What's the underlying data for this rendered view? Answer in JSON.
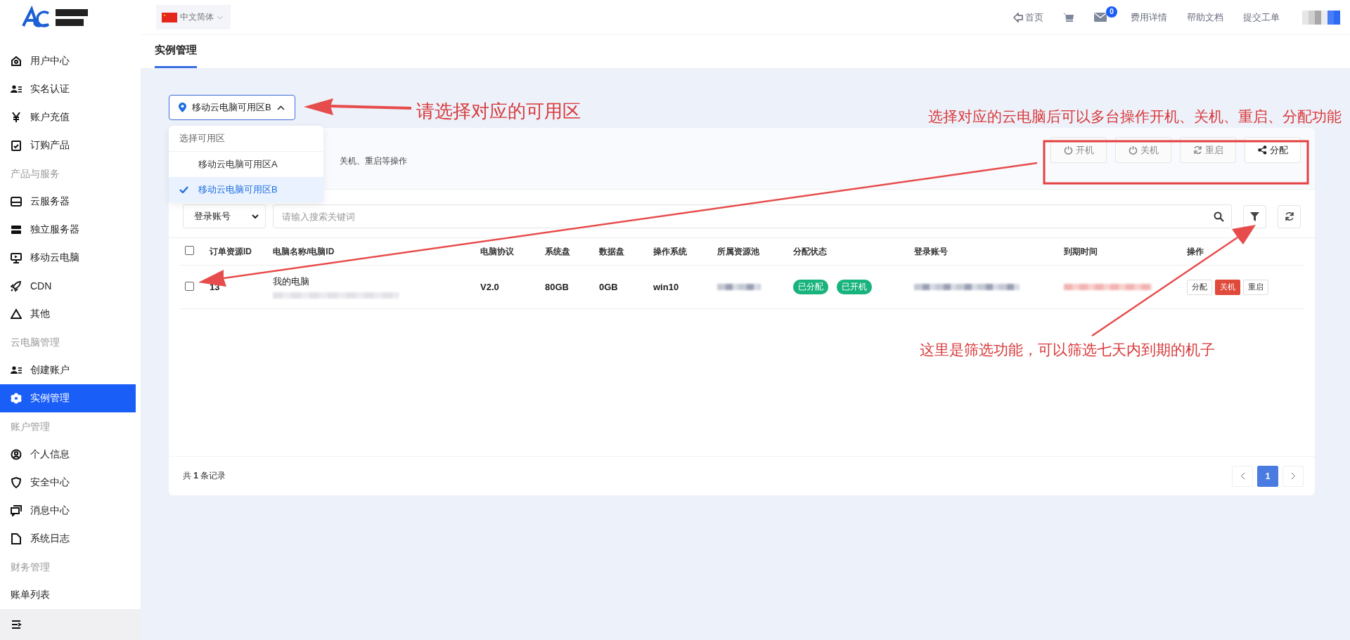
{
  "header": {
    "language": "中文简体",
    "nav": [
      {
        "kind": "home",
        "label": "首页"
      },
      {
        "kind": "cart"
      },
      {
        "kind": "mail",
        "badge": "0"
      },
      {
        "kind": "link",
        "label": "费用详情"
      },
      {
        "kind": "link",
        "label": "帮助文档"
      },
      {
        "kind": "link",
        "label": "提交工单"
      }
    ]
  },
  "sidebar": {
    "items": [
      {
        "kind": "item",
        "label": "用户中心",
        "selected": false
      },
      {
        "kind": "item",
        "label": "实名认证",
        "selected": false
      },
      {
        "kind": "item",
        "label": "账户充值",
        "selected": false
      },
      {
        "kind": "item",
        "label": "订购产品",
        "selected": false
      },
      {
        "kind": "heading",
        "label": "产品与服务"
      },
      {
        "kind": "item",
        "label": "云服务器",
        "selected": false
      },
      {
        "kind": "item",
        "label": "独立服务器",
        "selected": false
      },
      {
        "kind": "item",
        "label": "移动云电脑",
        "selected": false
      },
      {
        "kind": "item",
        "label": "CDN",
        "selected": false
      },
      {
        "kind": "item",
        "label": "其他",
        "selected": false
      },
      {
        "kind": "heading",
        "label": "云电脑管理"
      },
      {
        "kind": "item",
        "label": "创建账户",
        "selected": false
      },
      {
        "kind": "item",
        "label": "实例管理",
        "selected": true
      },
      {
        "kind": "heading",
        "label": "账户管理"
      },
      {
        "kind": "item",
        "label": "个人信息",
        "selected": false
      },
      {
        "kind": "item",
        "label": "安全中心",
        "selected": false
      },
      {
        "kind": "item",
        "label": "消息中心",
        "selected": false
      },
      {
        "kind": "item",
        "label": "系统日志",
        "selected": false
      },
      {
        "kind": "heading",
        "label": "财务管理"
      },
      {
        "kind": "item",
        "label": "账单列表",
        "selected": false
      }
    ]
  },
  "tabs": [
    {
      "label": "实例管理",
      "selected": true
    }
  ],
  "zone_select": {
    "value": "移动云电脑可用区B",
    "expanded": true,
    "menu_title": "选择可用区",
    "options": [
      {
        "label": "移动云电脑可用区A",
        "selected": false
      },
      {
        "label": "移动云电脑可用区B",
        "selected": true
      }
    ]
  },
  "card": {
    "description": "关机、重启等操作",
    "bulk_buttons": [
      {
        "kind": "power",
        "label": "开机",
        "disabled": true
      },
      {
        "kind": "power",
        "label": "关机",
        "disabled": true
      },
      {
        "kind": "restart",
        "label": "重启",
        "disabled": true
      },
      {
        "kind": "share",
        "label": "分配",
        "disabled": false
      }
    ],
    "search": {
      "field": "登录账号",
      "placeholder": "请输入搜索关键词"
    },
    "table": {
      "select_all_checked": false,
      "columns": [
        "订单资源ID",
        "电脑名称/电脑ID",
        "电脑协议",
        "系统盘",
        "数据盘",
        "操作系统",
        "所属资源池",
        "分配状态",
        "登录账号",
        "到期时间",
        "操作"
      ],
      "rows": [
        {
          "checked": false,
          "order_id": "13",
          "name": "我的电脑",
          "protocol": "V2.0",
          "system_disk": "80GB",
          "data_disk": "0GB",
          "os": "win10",
          "tags": [
            "已分配",
            "已开机"
          ],
          "actions": [
            {
              "label": "分配",
              "kind": "default"
            },
            {
              "label": "关机",
              "kind": "danger"
            },
            {
              "label": "重启",
              "kind": "default"
            }
          ]
        }
      ]
    },
    "total": "共 **1** 条记录",
    "pages": [
      {
        "label": "1",
        "selected": true
      }
    ]
  },
  "annotations": [
    "请选择对应的可用区",
    "选择对应的云电脑后可以多台操作开机、关机、重启、分配功能",
    "这里是筛选功能，可以筛选七天内到期的机子"
  ]
}
